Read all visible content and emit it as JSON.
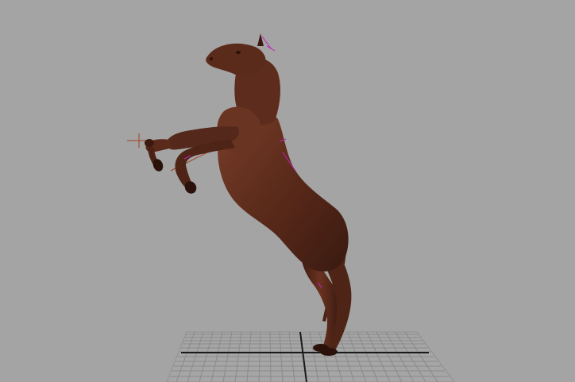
{
  "viewport": {
    "background_color": "#a4a4a4",
    "model": {
      "subject": "rearing-horse",
      "body_color": "#5a2a1a",
      "highlight_color": "#7a3e2a",
      "shadow_color": "#3a1a10"
    },
    "ground_grid": {
      "line_color": "#8a8a8a",
      "axis_color": "#1a1a1a"
    },
    "rig": {
      "joint_color": "#c020c0",
      "bone_color": "#a04020"
    }
  }
}
